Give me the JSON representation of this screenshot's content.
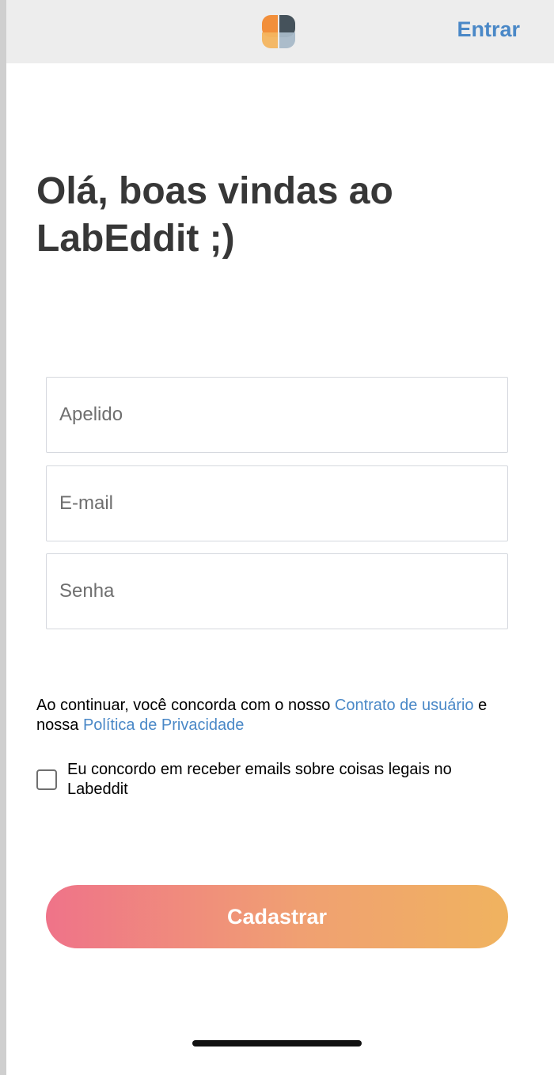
{
  "header": {
    "login_label": "Entrar"
  },
  "main": {
    "title": "Olá, boas vindas ao LabEddit ;)",
    "fields": {
      "nickname": {
        "placeholder": "Apelido",
        "value": ""
      },
      "email": {
        "placeholder": "E-mail",
        "value": ""
      },
      "password": {
        "placeholder": "Senha",
        "value": ""
      }
    },
    "terms": {
      "prefix": "Ao continuar, você concorda com o nosso ",
      "contract_link": "Contrato de usuário",
      "middle": " e nossa ",
      "privacy_link": "Política de Privacidade"
    },
    "consent": {
      "label": "Eu concordo em receber emails sobre coisas legais no Labeddit",
      "checked": false
    },
    "submit_label": "Cadastrar"
  },
  "icons": {
    "logo": "labeddit-logo-icon",
    "checkbox": "checkbox-icon"
  },
  "colors": {
    "link": "#4a88c7",
    "title": "#373737",
    "header_bg": "#ededed",
    "button_gradient_start": "#ef7389",
    "button_gradient_end": "#f0b35f",
    "logo_orange": "#f28f3b",
    "logo_dark": "#45525b"
  }
}
